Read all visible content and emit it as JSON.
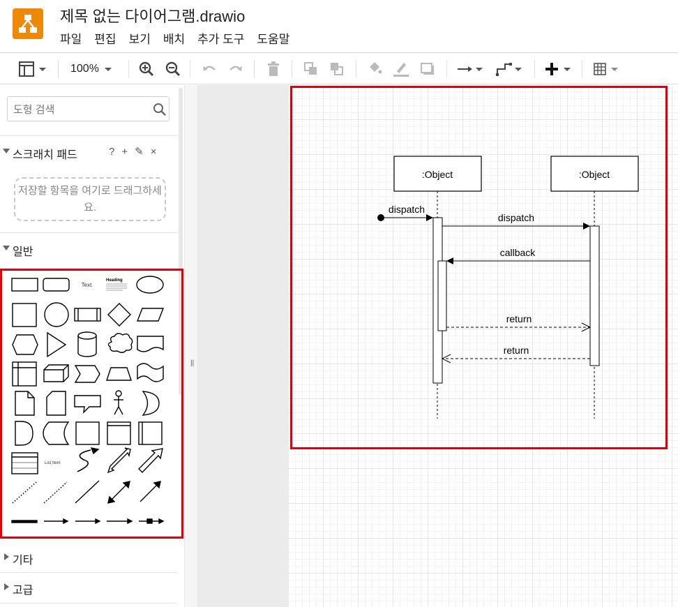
{
  "app": {
    "document_title": "제목 없는 다이어그램.drawio"
  },
  "menu": [
    "파일",
    "편집",
    "보기",
    "배치",
    "추가 도구",
    "도움말"
  ],
  "toolbar": {
    "zoom": "100%",
    "icons": [
      "format-panel-icon",
      "zoom-in-icon",
      "zoom-out-icon",
      "undo-icon",
      "redo-icon",
      "delete-icon",
      "to-front-icon",
      "to-back-icon",
      "fill-color-icon",
      "line-color-icon",
      "shadow-icon",
      "connection-icon",
      "waypoints-icon",
      "insert-icon",
      "table-icon"
    ]
  },
  "sidebar": {
    "search_placeholder": "도형 검색",
    "scratchpad": {
      "title": "스크래치 패드",
      "help": "?",
      "add": "+",
      "edit": "✎",
      "close": "×",
      "drop_hint": "저장할 항목을 여기로 드래그하세요."
    },
    "sections": {
      "general": "일반",
      "misc": "기타",
      "advanced": "고급"
    },
    "shape_labels": {
      "text": "Text",
      "heading": "Heading",
      "list_item": "List Item"
    }
  },
  "diagram": {
    "objects": [
      ":Object",
      ":Object"
    ],
    "messages": [
      "dispatch",
      "dispatch",
      "callback",
      "return",
      "return"
    ]
  },
  "colors": {
    "accent": "#f08705",
    "highlight": "#e0000b"
  }
}
